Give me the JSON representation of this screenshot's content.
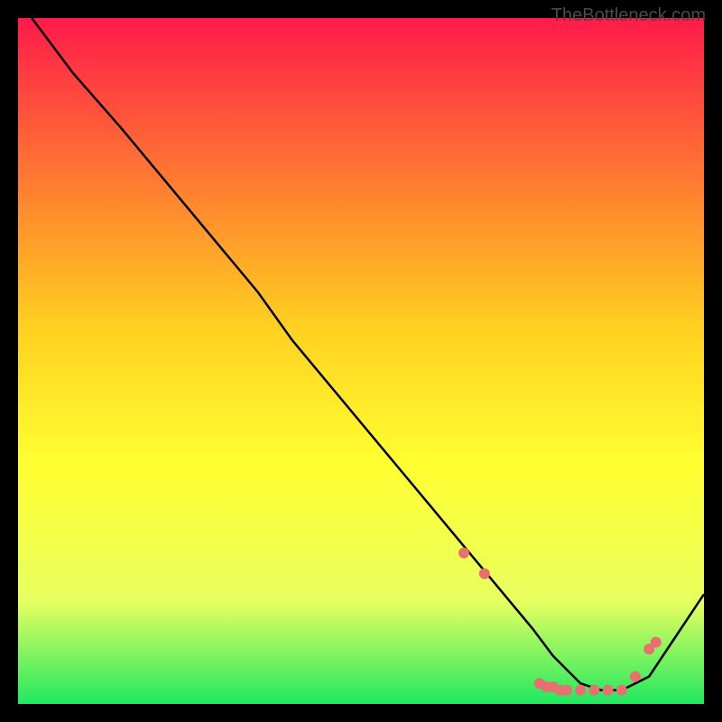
{
  "watermark": "TheBottleneck.com",
  "chart_data": {
    "type": "line",
    "title": "",
    "xlabel": "",
    "ylabel": "",
    "xlim": [
      0,
      100
    ],
    "ylim": [
      0,
      100
    ],
    "gradient_colors": {
      "top": "#ff1a4a",
      "upper_mid": "#ff8030",
      "mid": "#ffd020",
      "lower_mid": "#ffff30",
      "low": "#e8ff60",
      "bottom": "#20e860"
    },
    "series": [
      {
        "name": "bottleneck-curve",
        "x": [
          2,
          8,
          15,
          20,
          25,
          30,
          35,
          40,
          45,
          50,
          55,
          60,
          65,
          70,
          75,
          78,
          80,
          82,
          85,
          88,
          92,
          96,
          100
        ],
        "y": [
          100,
          92,
          84,
          78,
          72,
          66,
          60,
          53,
          47,
          41,
          35,
          29,
          23,
          17,
          11,
          7,
          5,
          3,
          2,
          2,
          4,
          10,
          16
        ]
      }
    ],
    "markers": {
      "name": "highlight-points",
      "color": "#e87070",
      "x": [
        65,
        68,
        76,
        77,
        78,
        79,
        80,
        82,
        84,
        86,
        88,
        90,
        92,
        93
      ],
      "y": [
        22,
        19,
        3,
        2.5,
        2.5,
        2,
        2,
        2,
        2,
        2,
        2,
        4,
        8,
        9
      ]
    }
  }
}
